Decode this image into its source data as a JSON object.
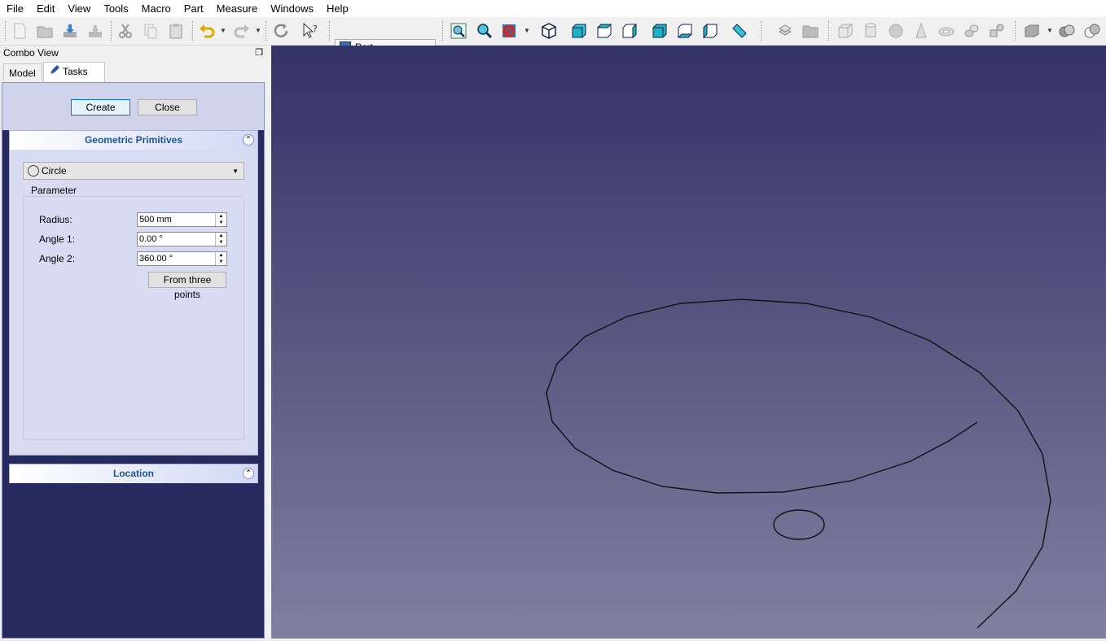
{
  "menu": [
    "File",
    "Edit",
    "View",
    "Tools",
    "Macro",
    "Part",
    "Measure",
    "Windows",
    "Help"
  ],
  "toolbar": {
    "workbench": "Part",
    "icons": [
      "new-icon",
      "open-icon",
      "save-icon",
      "save-as-icon",
      "cut-icon",
      "copy-icon",
      "paste-icon",
      "undo-icon",
      "redo-icon",
      "refresh-icon",
      "whats-this-icon",
      "fit-all-icon",
      "fit-selection-icon",
      "draw-style-icon",
      "isometric-icon",
      "front-view-icon",
      "top-view-icon",
      "right-view-icon",
      "rear-view-icon",
      "bottom-view-icon",
      "left-view-icon",
      "measure-icon",
      "extrude-icon",
      "folder-icon",
      "box-icon",
      "cylinder-icon",
      "sphere-icon",
      "cone-icon",
      "torus-icon",
      "tube-icon",
      "primitives-icon",
      "shape-builder-icon",
      "boolean-icon",
      "union-icon"
    ]
  },
  "combo": {
    "title": "Combo View",
    "tabs": {
      "model": "Model",
      "tasks": "Tasks"
    },
    "create_label": "Create",
    "close_label": "Close",
    "geometric_title": "Geometric Primitives",
    "shape": "Circle",
    "parameter_label": "Parameter",
    "fields": {
      "radius_label": "Radius:",
      "radius_value": "500 mm",
      "angle1_label": "Angle 1:",
      "angle1_value": "0.00 °",
      "angle2_label": "Angle 2:",
      "angle2_value": "360.00 °"
    },
    "three_points_label": "From three points",
    "location_title": "Location"
  },
  "colors": {
    "viewport_top": "#333366",
    "viewport_bottom": "#8080a0",
    "task_panel_bg": "#262a5e",
    "group_header_text": "#21558e"
  }
}
